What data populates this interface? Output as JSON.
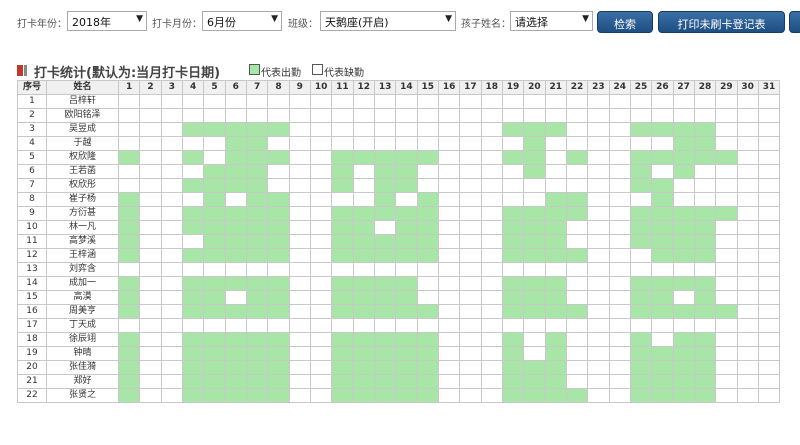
{
  "filters": {
    "year_label": "打卡年份：",
    "year_value": "2018年",
    "month_label": "打卡月份：",
    "month_value": "6月份",
    "class_label": "班级：",
    "class_value": "天鹅座(开启)",
    "child_label": "孩子姓名：",
    "child_value": "请选择",
    "search_button": "检索",
    "print_button": "打印未刷卡登记表"
  },
  "section": {
    "title": "打卡统计(默认为:当月打卡日期)",
    "legend_present": "代表出勤",
    "legend_absent": "代表缺勤"
  },
  "colors": {
    "present": "#a8e6a8",
    "absent": "#ffffff",
    "button": "#2b5f95"
  },
  "table": {
    "col_index": "序号",
    "col_name": "姓名",
    "days": [
      "1",
      "2",
      "3",
      "4",
      "5",
      "6",
      "7",
      "8",
      "9",
      "10",
      "11",
      "12",
      "13",
      "14",
      "15",
      "16",
      "17",
      "18",
      "19",
      "20",
      "21",
      "22",
      "23",
      "24",
      "25",
      "26",
      "27",
      "28",
      "29",
      "30",
      "31"
    ],
    "rows": [
      {
        "no": "1",
        "name": "吕梓轩",
        "attendance": [
          0,
          0,
          0,
          0,
          0,
          0,
          0,
          0,
          0,
          0,
          0,
          0,
          0,
          0,
          0,
          0,
          0,
          0,
          0,
          0,
          0,
          0,
          0,
          0,
          0,
          0,
          0,
          0,
          0,
          0,
          0
        ]
      },
      {
        "no": "2",
        "name": "欧阳铭泽",
        "attendance": [
          0,
          0,
          0,
          0,
          0,
          0,
          0,
          0,
          0,
          0,
          0,
          0,
          0,
          0,
          0,
          0,
          0,
          0,
          0,
          0,
          0,
          0,
          0,
          0,
          0,
          0,
          0,
          0,
          0,
          0,
          0
        ]
      },
      {
        "no": "3",
        "name": "吴昱成",
        "attendance": [
          0,
          0,
          0,
          1,
          1,
          1,
          1,
          1,
          0,
          0,
          0,
          0,
          0,
          0,
          0,
          0,
          0,
          0,
          1,
          1,
          1,
          0,
          0,
          0,
          1,
          1,
          1,
          1,
          0,
          0,
          0
        ]
      },
      {
        "no": "4",
        "name": "于越",
        "attendance": [
          0,
          0,
          0,
          0,
          0,
          1,
          1,
          0,
          0,
          0,
          0,
          0,
          0,
          0,
          0,
          0,
          0,
          0,
          0,
          1,
          0,
          0,
          0,
          0,
          0,
          0,
          1,
          1,
          0,
          0,
          0
        ]
      },
      {
        "no": "5",
        "name": "权欣隆",
        "attendance": [
          1,
          0,
          0,
          1,
          0,
          1,
          1,
          1,
          0,
          0,
          1,
          1,
          1,
          1,
          1,
          0,
          0,
          0,
          1,
          1,
          0,
          1,
          0,
          0,
          1,
          1,
          1,
          1,
          1,
          0,
          0
        ]
      },
      {
        "no": "6",
        "name": "王若菡",
        "attendance": [
          0,
          0,
          0,
          0,
          1,
          1,
          1,
          0,
          0,
          0,
          1,
          0,
          1,
          1,
          0,
          0,
          0,
          0,
          0,
          1,
          0,
          0,
          0,
          0,
          1,
          0,
          1,
          0,
          0,
          0,
          0
        ]
      },
      {
        "no": "7",
        "name": "权欣彤",
        "attendance": [
          0,
          0,
          0,
          1,
          1,
          1,
          1,
          0,
          0,
          0,
          1,
          0,
          1,
          1,
          0,
          0,
          0,
          0,
          0,
          0,
          0,
          0,
          0,
          0,
          1,
          1,
          0,
          0,
          0,
          0,
          0
        ]
      },
      {
        "no": "8",
        "name": "崔子杨",
        "attendance": [
          1,
          0,
          0,
          0,
          1,
          0,
          1,
          1,
          0,
          0,
          0,
          0,
          1,
          0,
          1,
          0,
          0,
          0,
          0,
          0,
          1,
          1,
          0,
          0,
          0,
          1,
          0,
          0,
          0,
          0,
          0
        ]
      },
      {
        "no": "9",
        "name": "方衍甚",
        "attendance": [
          1,
          0,
          0,
          1,
          1,
          1,
          1,
          1,
          0,
          0,
          1,
          1,
          1,
          1,
          1,
          0,
          0,
          0,
          1,
          1,
          1,
          1,
          0,
          0,
          1,
          1,
          1,
          1,
          1,
          0,
          0
        ]
      },
      {
        "no": "10",
        "name": "林一凡",
        "attendance": [
          1,
          0,
          0,
          1,
          1,
          1,
          1,
          1,
          0,
          0,
          1,
          1,
          0,
          1,
          1,
          0,
          0,
          0,
          1,
          1,
          1,
          0,
          0,
          0,
          1,
          1,
          1,
          1,
          0,
          0,
          0
        ]
      },
      {
        "no": "11",
        "name": "高梦溪",
        "attendance": [
          1,
          0,
          0,
          0,
          1,
          1,
          1,
          1,
          0,
          0,
          1,
          1,
          1,
          1,
          1,
          0,
          0,
          0,
          1,
          1,
          1,
          0,
          0,
          0,
          1,
          1,
          1,
          1,
          0,
          0,
          0
        ]
      },
      {
        "no": "12",
        "name": "王梓涵",
        "attendance": [
          1,
          0,
          0,
          1,
          1,
          1,
          1,
          1,
          0,
          0,
          1,
          1,
          1,
          1,
          1,
          0,
          0,
          0,
          1,
          1,
          1,
          1,
          0,
          0,
          0,
          1,
          1,
          1,
          0,
          0,
          0
        ]
      },
      {
        "no": "13",
        "name": "刘弈含",
        "attendance": [
          0,
          0,
          0,
          0,
          0,
          0,
          0,
          0,
          0,
          0,
          0,
          0,
          0,
          0,
          0,
          0,
          0,
          0,
          0,
          0,
          0,
          0,
          0,
          0,
          0,
          0,
          0,
          0,
          0,
          0,
          0
        ]
      },
      {
        "no": "14",
        "name": "成加一",
        "attendance": [
          1,
          0,
          0,
          1,
          1,
          1,
          1,
          1,
          0,
          0,
          1,
          1,
          1,
          1,
          0,
          0,
          0,
          0,
          1,
          1,
          1,
          0,
          0,
          0,
          1,
          1,
          1,
          1,
          0,
          0,
          0
        ]
      },
      {
        "no": "15",
        "name": "高漠",
        "attendance": [
          1,
          0,
          0,
          1,
          1,
          0,
          1,
          1,
          0,
          0,
          1,
          1,
          1,
          1,
          0,
          0,
          0,
          0,
          1,
          1,
          1,
          0,
          0,
          0,
          1,
          1,
          0,
          1,
          0,
          0,
          0
        ]
      },
      {
        "no": "16",
        "name": "周美亨",
        "attendance": [
          1,
          0,
          0,
          1,
          1,
          1,
          1,
          1,
          0,
          0,
          1,
          1,
          1,
          1,
          1,
          0,
          0,
          0,
          1,
          1,
          1,
          1,
          0,
          0,
          1,
          1,
          1,
          1,
          1,
          0,
          0
        ]
      },
      {
        "no": "17",
        "name": "丁天成",
        "attendance": [
          0,
          0,
          0,
          0,
          0,
          0,
          0,
          0,
          0,
          0,
          0,
          0,
          0,
          0,
          0,
          0,
          0,
          0,
          0,
          0,
          0,
          0,
          0,
          0,
          0,
          0,
          0,
          0,
          0,
          0,
          0
        ]
      },
      {
        "no": "18",
        "name": "徐辰翊",
        "attendance": [
          1,
          0,
          0,
          1,
          1,
          1,
          1,
          1,
          0,
          0,
          1,
          1,
          1,
          1,
          1,
          0,
          0,
          0,
          1,
          0,
          1,
          0,
          0,
          0,
          1,
          0,
          1,
          1,
          0,
          0,
          0
        ]
      },
      {
        "no": "19",
        "name": "钟晴",
        "attendance": [
          1,
          0,
          0,
          1,
          1,
          1,
          1,
          1,
          0,
          0,
          1,
          1,
          1,
          1,
          1,
          0,
          0,
          0,
          1,
          0,
          1,
          0,
          0,
          0,
          1,
          1,
          1,
          1,
          0,
          0,
          0
        ]
      },
      {
        "no": "20",
        "name": "张佳漪",
        "attendance": [
          1,
          0,
          0,
          1,
          1,
          1,
          1,
          1,
          0,
          0,
          1,
          1,
          1,
          1,
          1,
          0,
          0,
          0,
          1,
          1,
          1,
          0,
          0,
          0,
          1,
          1,
          1,
          1,
          0,
          0,
          0
        ]
      },
      {
        "no": "21",
        "name": "郑好",
        "attendance": [
          1,
          0,
          0,
          1,
          1,
          1,
          1,
          1,
          0,
          0,
          1,
          1,
          1,
          1,
          1,
          0,
          0,
          0,
          1,
          1,
          1,
          0,
          0,
          0,
          1,
          1,
          1,
          1,
          0,
          0,
          0
        ]
      },
      {
        "no": "22",
        "name": "张贤之",
        "attendance": [
          1,
          0,
          0,
          1,
          1,
          1,
          1,
          1,
          0,
          0,
          1,
          1,
          1,
          1,
          1,
          0,
          0,
          0,
          1,
          1,
          1,
          1,
          0,
          0,
          1,
          1,
          1,
          1,
          0,
          0,
          0
        ]
      }
    ]
  }
}
